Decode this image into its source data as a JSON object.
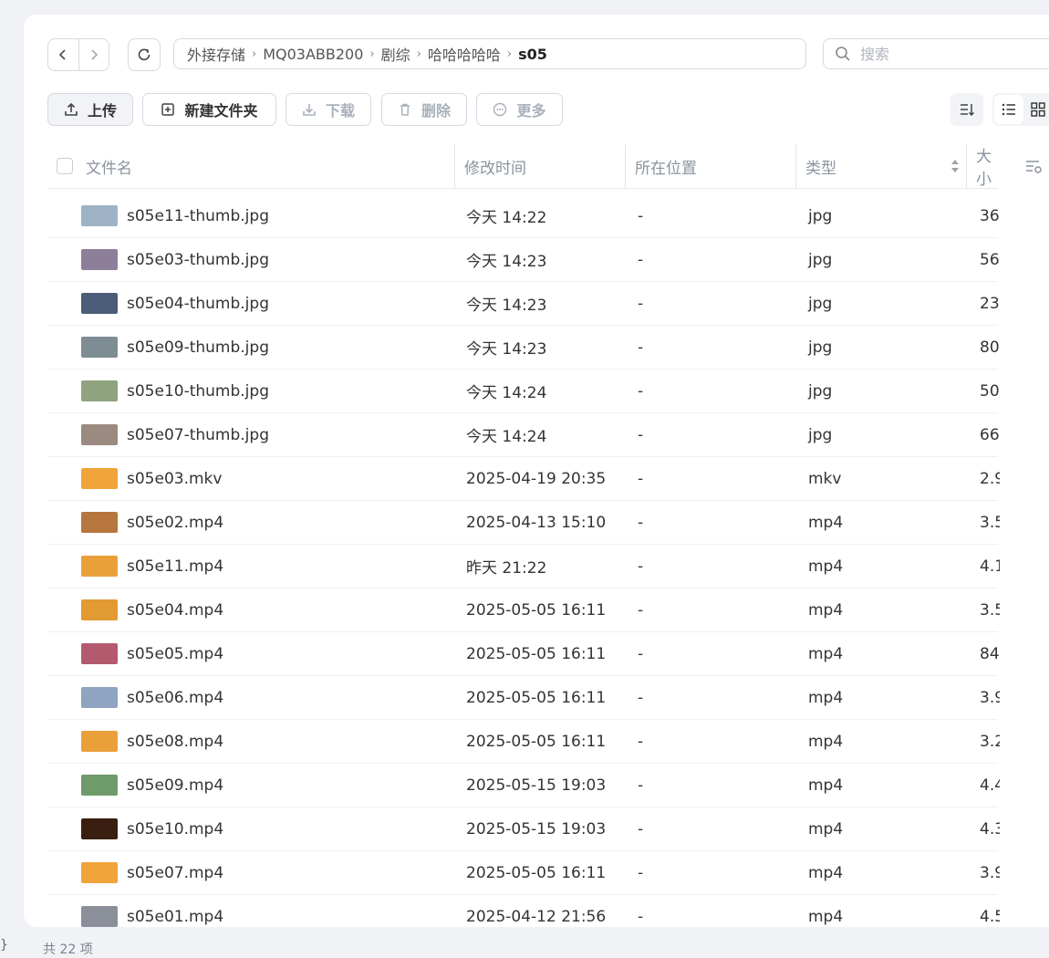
{
  "breadcrumb": [
    "外接存储",
    "MQ03ABB200",
    "剧综",
    "哈哈哈哈哈",
    "s05"
  ],
  "search": {
    "placeholder": "搜索"
  },
  "toolbar": {
    "upload": "上传",
    "new_folder": "新建文件夹",
    "download": "下载",
    "delete": "删除",
    "more": "更多"
  },
  "columns": {
    "name": "文件名",
    "modified": "修改时间",
    "location": "所在位置",
    "type": "类型",
    "size": "大小"
  },
  "files": [
    {
      "name": "s05e11-thumb.jpg",
      "modified": "今天 14:22",
      "location": "-",
      "type": "jpg",
      "size": "36",
      "thumb": "#9fb3c6"
    },
    {
      "name": "s05e03-thumb.jpg",
      "modified": "今天 14:23",
      "location": "-",
      "type": "jpg",
      "size": "56",
      "thumb": "#8d7f9a"
    },
    {
      "name": "s05e04-thumb.jpg",
      "modified": "今天 14:23",
      "location": "-",
      "type": "jpg",
      "size": "23",
      "thumb": "#4c5d7a"
    },
    {
      "name": "s05e09-thumb.jpg",
      "modified": "今天 14:23",
      "location": "-",
      "type": "jpg",
      "size": "80",
      "thumb": "#7e8c94"
    },
    {
      "name": "s05e10-thumb.jpg",
      "modified": "今天 14:24",
      "location": "-",
      "type": "jpg",
      "size": "50",
      "thumb": "#8fa37e"
    },
    {
      "name": "s05e07-thumb.jpg",
      "modified": "今天 14:24",
      "location": "-",
      "type": "jpg",
      "size": "66",
      "thumb": "#9b8a80"
    },
    {
      "name": "s05e03.mkv",
      "modified": "2025-04-19 20:35",
      "location": "-",
      "type": "mkv",
      "size": "2.9",
      "thumb": "#f0a43a"
    },
    {
      "name": "s05e02.mp4",
      "modified": "2025-04-13 15:10",
      "location": "-",
      "type": "mp4",
      "size": "3.5",
      "thumb": "#b7763e"
    },
    {
      "name": "s05e11.mp4",
      "modified": "昨天 21:22",
      "location": "-",
      "type": "mp4",
      "size": "4.1",
      "thumb": "#e9a03a"
    },
    {
      "name": "s05e04.mp4",
      "modified": "2025-05-05 16:11",
      "location": "-",
      "type": "mp4",
      "size": "3.5",
      "thumb": "#e29a32"
    },
    {
      "name": "s05e05.mp4",
      "modified": "2025-05-05 16:11",
      "location": "-",
      "type": "mp4",
      "size": "84",
      "thumb": "#b45a6e"
    },
    {
      "name": "s05e06.mp4",
      "modified": "2025-05-05 16:11",
      "location": "-",
      "type": "mp4",
      "size": "3.9",
      "thumb": "#8fa4c0"
    },
    {
      "name": "s05e08.mp4",
      "modified": "2025-05-05 16:11",
      "location": "-",
      "type": "mp4",
      "size": "3.2",
      "thumb": "#e9a03a"
    },
    {
      "name": "s05e09.mp4",
      "modified": "2025-05-15 19:03",
      "location": "-",
      "type": "mp4",
      "size": "4.4",
      "thumb": "#6f9a6a"
    },
    {
      "name": "s05e10.mp4",
      "modified": "2025-05-15 19:03",
      "location": "-",
      "type": "mp4",
      "size": "4.3",
      "thumb": "#3a1e10"
    },
    {
      "name": "s05e07.mp4",
      "modified": "2025-05-05 16:11",
      "location": "-",
      "type": "mp4",
      "size": "3.9",
      "thumb": "#f0a43a"
    },
    {
      "name": "s05e01.mp4",
      "modified": "2025-04-12 21:56",
      "location": "-",
      "type": "mp4",
      "size": "4.5",
      "thumb": "#8a8f99"
    }
  ],
  "footer": {
    "count": "共 22 项"
  },
  "colors": {
    "background": "#f0f2f6",
    "panel": "#ffffff",
    "border": "#d5d9e0",
    "muted": "#8a93a0"
  }
}
